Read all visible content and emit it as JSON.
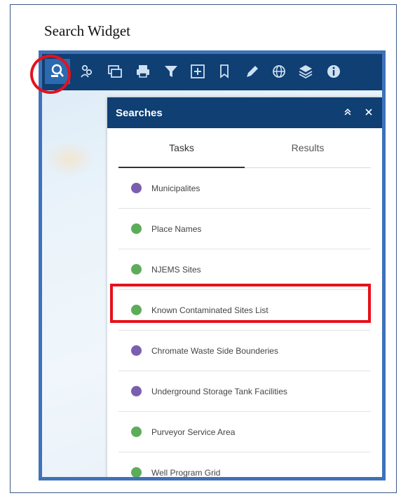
{
  "caption": "Search Widget",
  "colors": {
    "toolbar": "#0f3f73",
    "panel_header": "#0f3f73",
    "frame_border": "#3f72b8",
    "highlight": "#e8101a",
    "icon_purple": "#7a5fb0",
    "icon_green": "#5cad5a"
  },
  "toolbar": {
    "tools": [
      {
        "icon": "search-icon",
        "active": true
      },
      {
        "icon": "people-icon"
      },
      {
        "icon": "map-gallery-icon"
      },
      {
        "icon": "print-icon"
      },
      {
        "icon": "filter-icon"
      },
      {
        "icon": "add-data-icon"
      },
      {
        "icon": "bookmark-icon"
      },
      {
        "icon": "draw-icon"
      },
      {
        "icon": "globe-icon"
      },
      {
        "icon": "layers-icon"
      },
      {
        "icon": "info-icon"
      }
    ]
  },
  "panel": {
    "title": "Searches",
    "tabs": [
      {
        "label": "Tasks",
        "active": true
      },
      {
        "label": "Results",
        "active": false
      }
    ],
    "tasks": [
      {
        "label": "Municipalites",
        "icon": "purple"
      },
      {
        "label": "Place Names",
        "icon": "green"
      },
      {
        "label": "NJEMS Sites",
        "icon": "green"
      },
      {
        "label": "Known Contaminated Sites List",
        "icon": "green",
        "highlighted": true
      },
      {
        "label": "Chromate Waste Side Bounderies",
        "icon": "purple"
      },
      {
        "label": "Underground Storage Tank Facilities",
        "icon": "purple"
      },
      {
        "label": "Purveyor Service Area",
        "icon": "green"
      },
      {
        "label": "Well Program Grid",
        "icon": "green"
      }
    ]
  }
}
